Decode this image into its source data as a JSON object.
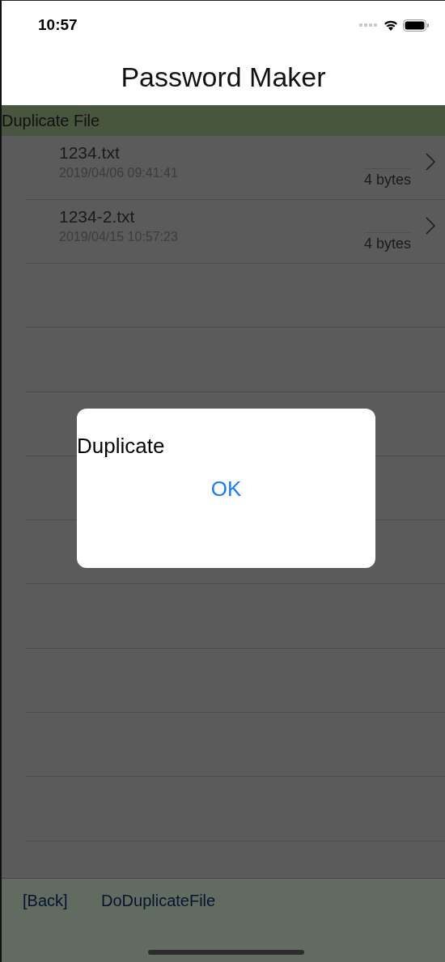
{
  "status_bar": {
    "time": "10:57"
  },
  "nav": {
    "title": "Password Maker"
  },
  "section": {
    "title": "Duplicate File"
  },
  "files": [
    {
      "name": "1234.txt",
      "date": "2019/04/06  09:41:41",
      "size": "4 bytes"
    },
    {
      "name": "1234-2.txt",
      "date": "2019/04/15  10:57:23",
      "size": "4 bytes"
    }
  ],
  "toolbar": {
    "items": [
      "[Back]",
      "DoDuplicateFile"
    ]
  },
  "alert": {
    "message": "Duplicate",
    "button": "OK"
  }
}
